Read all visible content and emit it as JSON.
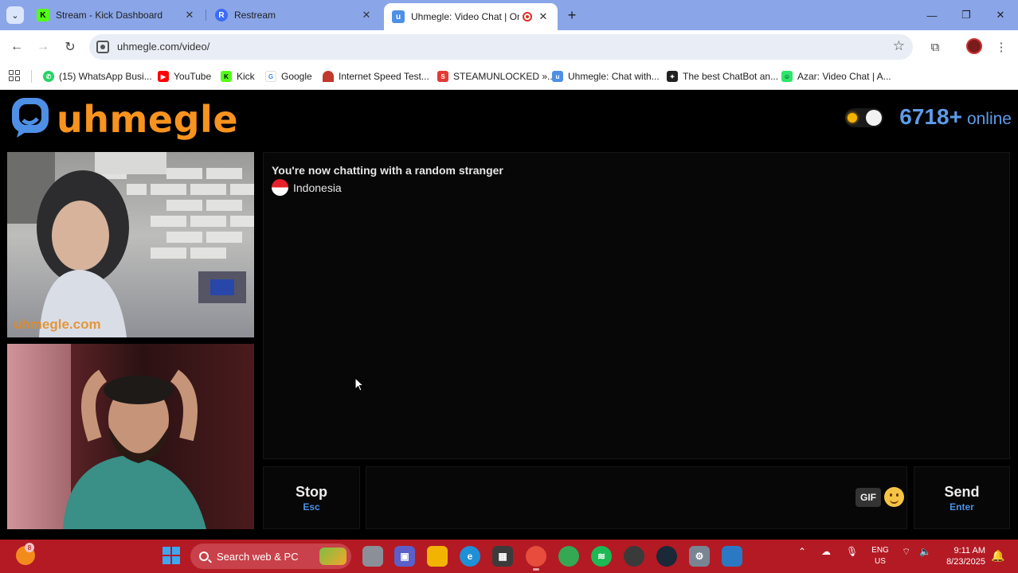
{
  "browser": {
    "tabs": [
      {
        "title": "Stream - Kick Dashboard",
        "favicon": "kick-icon",
        "color": "#53fc18"
      },
      {
        "title": "Restream",
        "favicon": "restream-icon",
        "color": "#3b6cf6"
      },
      {
        "title": "Uhmegle: Video Chat | Ome",
        "favicon": "uhmegle-icon",
        "color": "#4d90e6",
        "active": true,
        "recording": true
      }
    ],
    "url": "uhmegle.com/video/",
    "bookmarks": [
      {
        "label": "(15) WhatsApp Busi...",
        "icon": "whatsapp-icon",
        "color": "#25d366"
      },
      {
        "label": "YouTube",
        "icon": "youtube-icon",
        "color": "#ff0000"
      },
      {
        "label": "Kick",
        "icon": "kick-icon",
        "color": "#53fc18"
      },
      {
        "label": "Google",
        "icon": "google-icon",
        "color": "#4285f4"
      },
      {
        "label": "Internet Speed Test...",
        "icon": "speedtest-icon",
        "color": "#c0392b"
      },
      {
        "label": "STEAMUNLOCKED »...",
        "icon": "steamunlocked-icon",
        "color": "#e53935"
      },
      {
        "label": "Uhmegle: Chat with...",
        "icon": "uhmegle-icon",
        "color": "#4d90e6"
      },
      {
        "label": "The best ChatBot an...",
        "icon": "chatbot-icon",
        "color": "#222222"
      },
      {
        "label": "Azar: Video Chat | A...",
        "icon": "azar-icon",
        "color": "#2ee66b"
      }
    ]
  },
  "site": {
    "logo_text": "uhmegle",
    "logo_color": "#f7931e",
    "online_count": "6718+",
    "online_label": "online",
    "online_color": "#5e9be8",
    "stranger_watermark": "uhmegle.com"
  },
  "chat": {
    "status": "You're now chatting with a random stranger",
    "country": "Indonesia",
    "flag": "indonesia-flag-icon"
  },
  "controls": {
    "stop_label": "Stop",
    "stop_key": "Esc",
    "gif_label": "GIF",
    "send_label": "Send",
    "send_key": "Enter",
    "key_color": "#4d90e6"
  },
  "taskbar": {
    "widget_badge": "8",
    "search_placeholder": "Search web & PC",
    "lang_line1": "ENG",
    "lang_line2": "US",
    "time": "9:11 AM",
    "date": "8/23/2025",
    "accent": "#b31a24"
  }
}
